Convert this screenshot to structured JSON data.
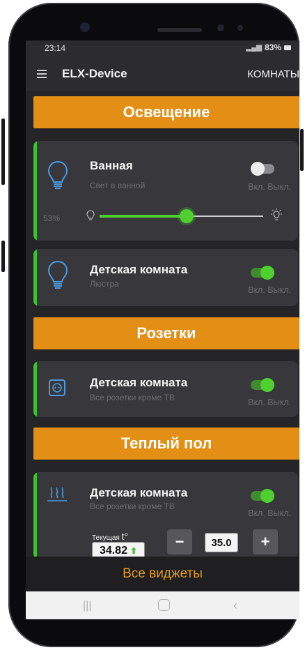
{
  "status": {
    "time": "23:14",
    "battery": "83%"
  },
  "appbar": {
    "title": "ELX-Device",
    "rooms": "КОМНАТЫ"
  },
  "sections": {
    "lighting": "Освещение",
    "sockets": "Розетки",
    "floor": "Теплый пол"
  },
  "cards": {
    "bathroom": {
      "title": "Ванная",
      "subtitle": "Свет в ванной",
      "onoff": "Вкл. Выкл.",
      "brightness_label": "53%",
      "brightness": 0.53,
      "switch": "off"
    },
    "kids_light": {
      "title": "Детская комната",
      "subtitle": "Люстра",
      "onoff": "Вкл. Выкл.",
      "switch": "on"
    },
    "kids_socket": {
      "title": "Детская комната",
      "subtitle": "Все розетки кроме ТВ",
      "onoff": "Вкл. Выкл.",
      "switch": "on"
    },
    "kids_floor": {
      "title": "Детская комната",
      "subtitle": "Все розетки кроме ТВ",
      "onoff": "Вкл. Выкл.",
      "switch": "on",
      "current_label": "Текущая",
      "temp_symbol": "t°",
      "current_value": "34.82",
      "setpoint": "35.0",
      "minus": "−",
      "plus": "+"
    }
  },
  "bottom": {
    "all_widgets": "Все виджеты"
  },
  "colors": {
    "accent": "#E38F16",
    "green": "#3EC22E",
    "icon_blue": "#4A9BE0",
    "card": "#37373C",
    "bg": "#252528"
  }
}
